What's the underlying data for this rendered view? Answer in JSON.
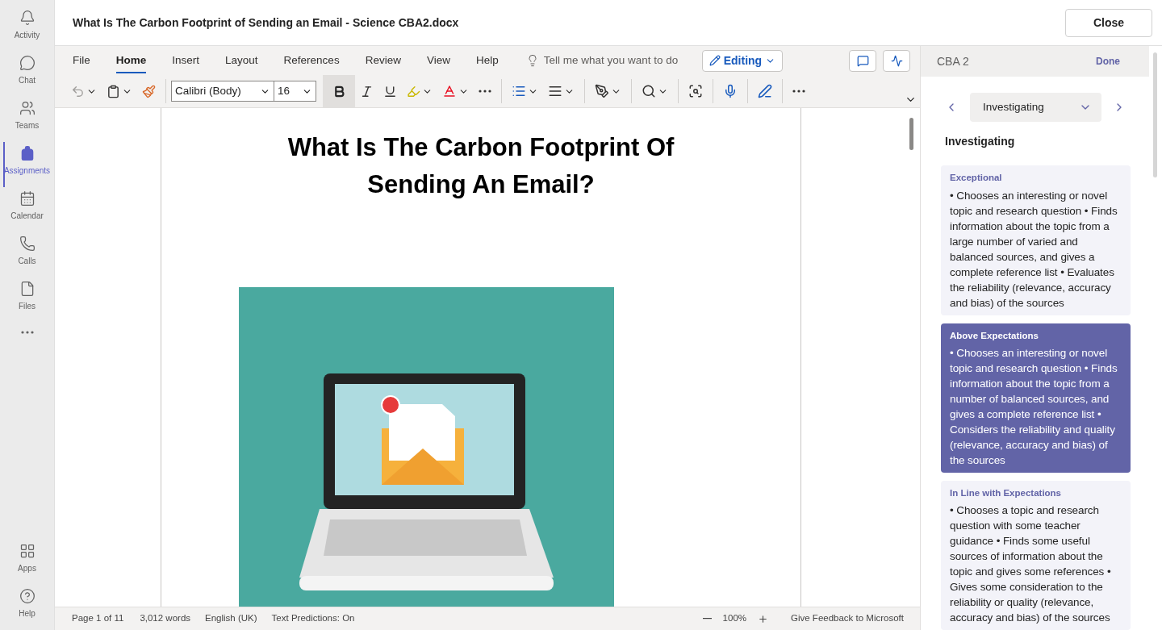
{
  "rail": [
    {
      "label": "Activity",
      "kind": "bell",
      "selected": false
    },
    {
      "label": "Chat",
      "kind": "chat",
      "selected": false
    },
    {
      "label": "Teams",
      "kind": "teams",
      "selected": false
    },
    {
      "label": "Assignments",
      "kind": "backpack",
      "selected": true
    },
    {
      "label": "Calendar",
      "kind": "calendar",
      "selected": false
    },
    {
      "label": "Calls",
      "kind": "phone",
      "selected": false
    },
    {
      "label": "Files",
      "kind": "file",
      "selected": false
    }
  ],
  "rail_bottom": [
    {
      "label": "Apps",
      "kind": "apps"
    },
    {
      "label": "Help",
      "kind": "help"
    }
  ],
  "window": {
    "title": "What Is The Carbon Footprint of Sending an Email - Science CBA2.docx",
    "close": "Close"
  },
  "ribbon": {
    "tabs": [
      {
        "label": "File",
        "selected": false
      },
      {
        "label": "Home",
        "selected": true
      },
      {
        "label": "Insert",
        "selected": false
      },
      {
        "label": "Layout",
        "selected": false
      },
      {
        "label": "References",
        "selected": false
      },
      {
        "label": "Review",
        "selected": false
      },
      {
        "label": "View",
        "selected": false
      },
      {
        "label": "Help",
        "selected": false
      }
    ],
    "search": {
      "placeholder": "Tell me what you want to do"
    },
    "mode": "Editing",
    "font": "Calibri (Body)",
    "size": "16",
    "bold": true
  },
  "document": {
    "title": "What Is The Carbon Footprint Of Sending An Email?"
  },
  "status_bar": {
    "page": "Page 1 of 11",
    "words": "3,012 words",
    "language": "English (UK)",
    "predictions": "Text Predictions: On",
    "zoom": "100%",
    "feedback": "Give Feedback to Microsoft"
  },
  "rubric": {
    "title": "CBA 2",
    "done": "Done",
    "criterion": "Investigating",
    "heading": "Investigating",
    "levels": [
      {
        "name": "Exceptional",
        "selected": false,
        "text": "• Chooses an interesting or novel topic and research question • Finds information about the topic from a large number of varied and balanced sources, and gives a complete reference list • Evaluates the reliability (relevance, accuracy and bias) of the sources"
      },
      {
        "name": "Above Expectations",
        "selected": true,
        "text": "• Chooses an interesting or novel topic and research question • Finds information about the topic from a number of balanced sources, and gives a complete reference list • Considers the reliability and quality (relevance, accuracy and bias) of the sources"
      },
      {
        "name": "In Line with Expectations",
        "selected": false,
        "text": "• Chooses a topic and research question with some teacher guidance • Finds some useful sources of information about the topic and gives some references • Gives some consideration to the reliability or quality (relevance, accuracy and bias) of the sources"
      }
    ]
  }
}
